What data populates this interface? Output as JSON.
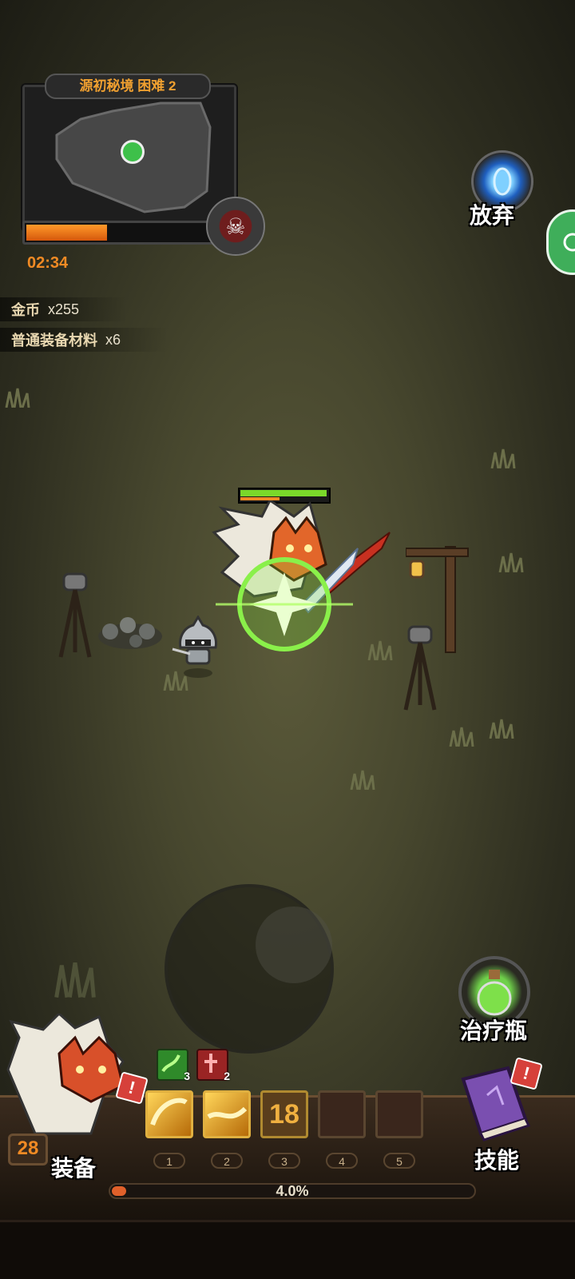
{
  "minimap": {
    "title": "源初秘境 困难 2",
    "timer": "02:34",
    "progress_fraction": 0.43
  },
  "rewards": [
    {
      "name": "金币",
      "count": "x255"
    },
    {
      "name": "普通装备材料",
      "count": "x6"
    }
  ],
  "buttons": {
    "abandon": "放弃",
    "potion": "治疗瓶",
    "equipment": "装备",
    "skills": "技能"
  },
  "player": {
    "level": "28"
  },
  "enemy": {
    "health_fraction": 1.0,
    "stagger_fraction": 0.45
  },
  "buffs": [
    {
      "icon": "green-poison-icon",
      "count": "3"
    },
    {
      "icon": "red-blood-icon",
      "count": "2"
    }
  ],
  "skill_slots": [
    {
      "number": "1",
      "state": "filled",
      "icon": "golden-slash-icon"
    },
    {
      "number": "2",
      "state": "filled",
      "icon": "golden-wave-icon"
    },
    {
      "number": "3",
      "state": "cooldown",
      "cooldown": "18"
    },
    {
      "number": "4",
      "state": "empty"
    },
    {
      "number": "5",
      "state": "empty"
    }
  ],
  "xp": {
    "label": "4.0%",
    "fraction": 0.04
  },
  "colors": {
    "accent_orange": "#f08a24",
    "health_green": "#7ad82a",
    "alert_red": "#d6403a"
  }
}
